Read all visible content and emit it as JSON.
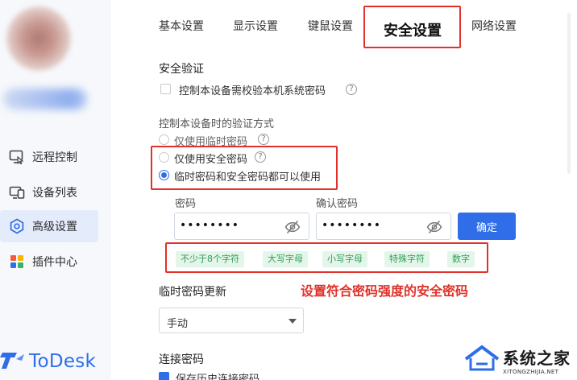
{
  "sidebar": {
    "items": [
      {
        "label": "远程控制",
        "icon": "remote-control-icon",
        "active": false
      },
      {
        "label": "设备列表",
        "icon": "device-list-icon",
        "active": false
      },
      {
        "label": "高级设置",
        "icon": "advanced-settings-icon",
        "active": true
      },
      {
        "label": "插件中心",
        "icon": "plugin-center-icon",
        "active": false
      }
    ],
    "brand": "ToDesk"
  },
  "tabs": [
    {
      "label": "基本设置",
      "active": false
    },
    {
      "label": "显示设置",
      "active": false
    },
    {
      "label": "键鼠设置",
      "active": false
    },
    {
      "label": "安全设置",
      "active": true
    },
    {
      "label": "网络设置",
      "active": false
    }
  ],
  "security": {
    "title": "安全验证",
    "verify_local_password": {
      "label": "控制本设备需校验本机系统密码",
      "checked": false
    },
    "verify_method_title": "控制本设备时的验证方式",
    "options": [
      {
        "label": "仅使用临时密码",
        "checked": false
      },
      {
        "label": "仅使用安全密码",
        "checked": false
      },
      {
        "label": "临时密码和安全密码都可以使用",
        "checked": true
      }
    ],
    "password_label": "密码",
    "password_value": "••••••••",
    "confirm_label": "确认密码",
    "confirm_value": "••••••••",
    "confirm_button": "确定",
    "requirements": [
      "不少于8个字符",
      "大写字母",
      "小写字母",
      "特殊字符",
      "数字"
    ]
  },
  "annotation": "设置符合密码强度的安全密码",
  "temp_password": {
    "title": "临时密码更新",
    "selected": "手动"
  },
  "connect_password": {
    "title": "连接密码",
    "partial": "保存历史连接密码"
  },
  "watermark": {
    "main": "系统之家",
    "sub": "XITONGZHIJIA.NET"
  },
  "colors": {
    "accent": "#2f6ee8",
    "highlight": "#e0312a",
    "tag_bg": "#e3f6e9",
    "tag_text": "#2f9d5a"
  }
}
